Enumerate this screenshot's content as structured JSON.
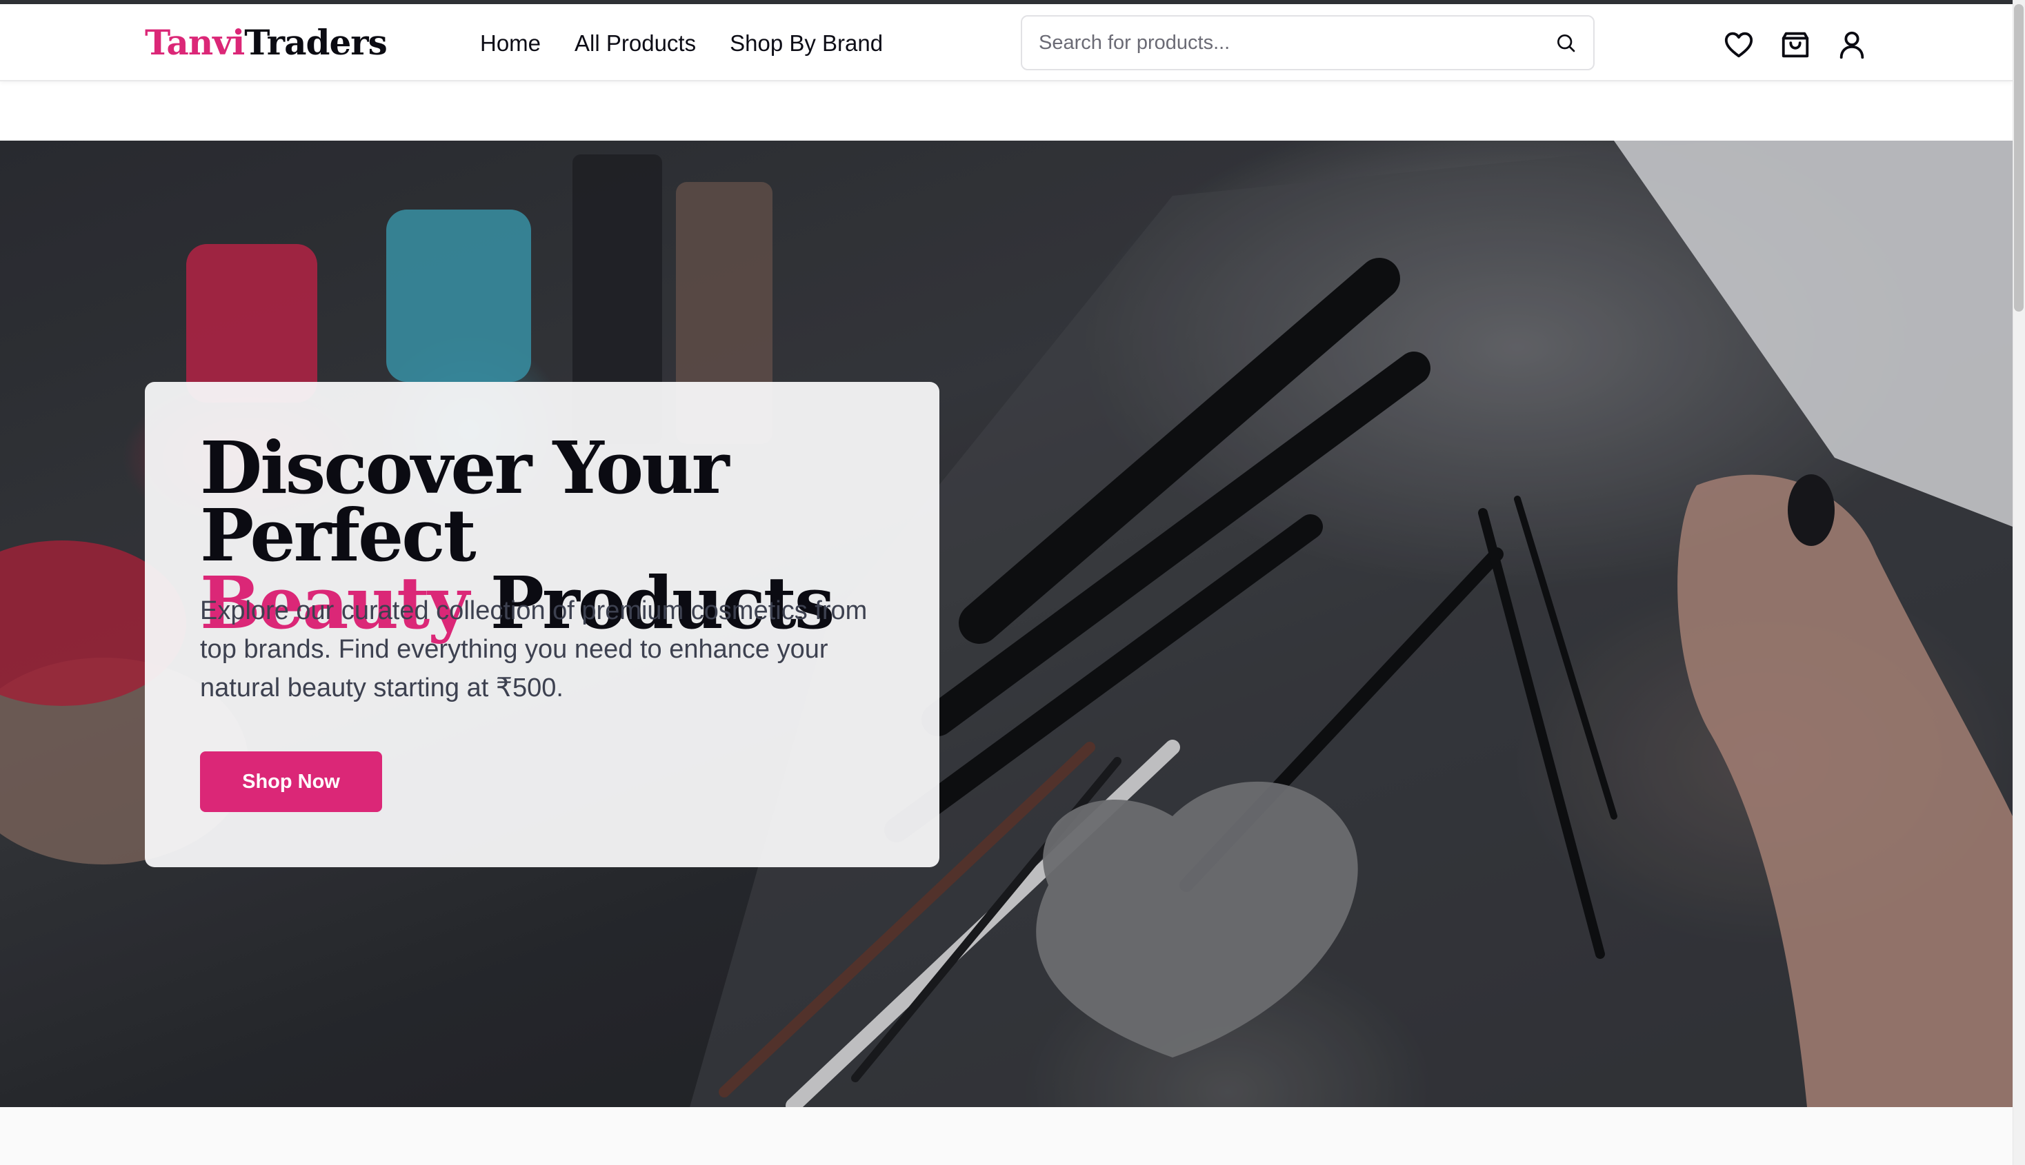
{
  "header": {
    "logo_part1": "Tanvi",
    "logo_part2": "Traders",
    "nav": [
      "Home",
      "All Products",
      "Shop By Brand"
    ],
    "search_placeholder": "Search for products...",
    "icons": [
      "heart-icon",
      "shopping-bag-icon",
      "user-icon"
    ]
  },
  "hero": {
    "title_line1": "Discover Your Perfect",
    "title_accent": "Beauty",
    "title_rest": "Products",
    "description": "Explore our curated collection of premium cosmetics from top brands. Find everything you need to enhance your natural beauty starting at ₹500.",
    "cta_label": "Shop Now"
  },
  "colors": {
    "accent": "#db2777",
    "text_dark": "#0b0b12",
    "text_body": "#3d4150"
  }
}
